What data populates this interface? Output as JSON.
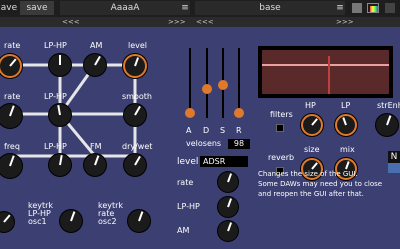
{
  "toolbar": {
    "left_label": "ave",
    "save_label": "save",
    "preset_name": "AaaaA",
    "bank_name": "base",
    "nav_prev": "<<<",
    "nav_next": ">>>",
    "menu_icon": "hamburger-icon",
    "color_swatch": "#c04040"
  },
  "matrix": {
    "rows": [
      [
        "rate",
        "LP-HP",
        "AM",
        "level"
      ],
      [
        "rate",
        "LP-HP",
        "",
        "smooth"
      ],
      [
        "freq",
        "LP-HP",
        "FM",
        "dry/wet"
      ],
      [
        "keytrk\nLP-HP\nosc1",
        "keytrk\nrate\nosc2"
      ]
    ]
  },
  "env": {
    "labels": [
      "A",
      "D",
      "S",
      "R"
    ],
    "velosens_label": "velosens",
    "velosens_value": "98"
  },
  "mod": {
    "level_label": "level",
    "level_value": "ADSR",
    "rate_label": "rate",
    "lphp_label": "LP-HP",
    "am_label": "AM"
  },
  "filters": {
    "filters_label": "filters",
    "hp_label": "HP",
    "lp_label": "LP",
    "streh_label": "strEnh",
    "reverb_label": "reverb",
    "size_label": "size",
    "mix_label": "mix"
  },
  "right_edge": {
    "n_label": "N"
  },
  "help": {
    "line1": "Changes the size of the GUI.",
    "line2": "Some DAWs may need you to close",
    "line3": "and reopen the GUI after that."
  }
}
